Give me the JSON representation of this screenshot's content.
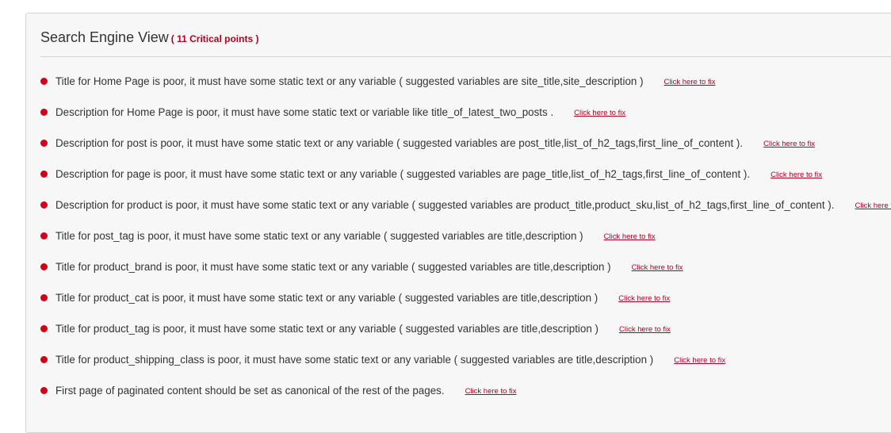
{
  "panel": {
    "title": "Search Engine View",
    "critical_label": "( 11 Critical points )"
  },
  "colors": {
    "bullet": "#d0021b",
    "link": "#b5001f",
    "text": "#333333",
    "panel_bg": "#f7f7f7"
  },
  "icons": {
    "bullet": "red-dot-icon"
  },
  "issues": [
    {
      "text": "Title for Home Page is poor, it must have some static text or any variable ( suggested variables are site_title,site_description )",
      "link": "Click here to fix"
    },
    {
      "text": "Description for Home Page is poor, it must have some static text or variable like title_of_latest_two_posts .",
      "link": "Click here to fix"
    },
    {
      "text": "Description for post is poor, it must have some static text or any variable ( suggested variables are post_title,list_of_h2_tags,first_line_of_content ).",
      "link": "Click here to fix"
    },
    {
      "text": "Description for page is poor, it must have some static text or any variable ( suggested variables are page_title,list_of_h2_tags,first_line_of_content ).",
      "link": "Click here to fix"
    },
    {
      "text": "Description for product is poor, it must have some static text or any variable ( suggested variables are product_title,product_sku,list_of_h2_tags,first_line_of_content ).",
      "link": "Click here to fix"
    },
    {
      "text": "Title for post_tag is poor, it must have some static text or any variable ( suggested variables are title,description )",
      "link": "Click here to fix"
    },
    {
      "text": "Title for product_brand is poor, it must have some static text or any variable ( suggested variables are title,description )",
      "link": "Click here to fix"
    },
    {
      "text": "Title for product_cat is poor, it must have some static text or any variable ( suggested variables are title,description )",
      "link": "Click here to fix"
    },
    {
      "text": "Title for product_tag is poor, it must have some static text or any variable ( suggested variables are title,description )",
      "link": "Click here to fix"
    },
    {
      "text": "Title for product_shipping_class is poor, it must have some static text or any variable ( suggested variables are title,description )",
      "link": "Click here to fix"
    },
    {
      "text": "First page of paginated content should be set as canonical of the rest of the pages.",
      "link": "Click here to fix"
    }
  ]
}
